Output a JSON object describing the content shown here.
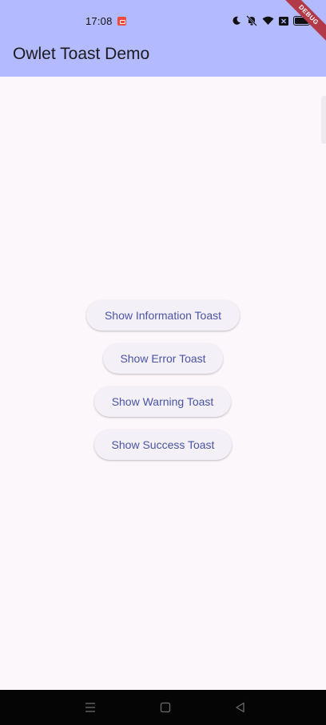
{
  "status_bar": {
    "time": "17:08"
  },
  "app_bar": {
    "title": "Owlet Toast Demo"
  },
  "debug_banner": "DEBUG",
  "buttons": {
    "information": "Show Information Toast",
    "error": "Show Error Toast",
    "warning": "Show Warning Toast",
    "success": "Show Success Toast"
  },
  "colors": {
    "app_bar": "#b3baff",
    "background": "#fcf7fb",
    "button_bg": "#f4f0f7",
    "button_text": "#4a53a4",
    "debug_ribbon": "#b23a48",
    "nav_bar": "#050505"
  },
  "icons": [
    "recording-icon",
    "moon-icon",
    "mute-icon",
    "wifi-icon",
    "sim-off-icon",
    "battery-icon",
    "menu-icon",
    "home-icon",
    "back-icon"
  ]
}
